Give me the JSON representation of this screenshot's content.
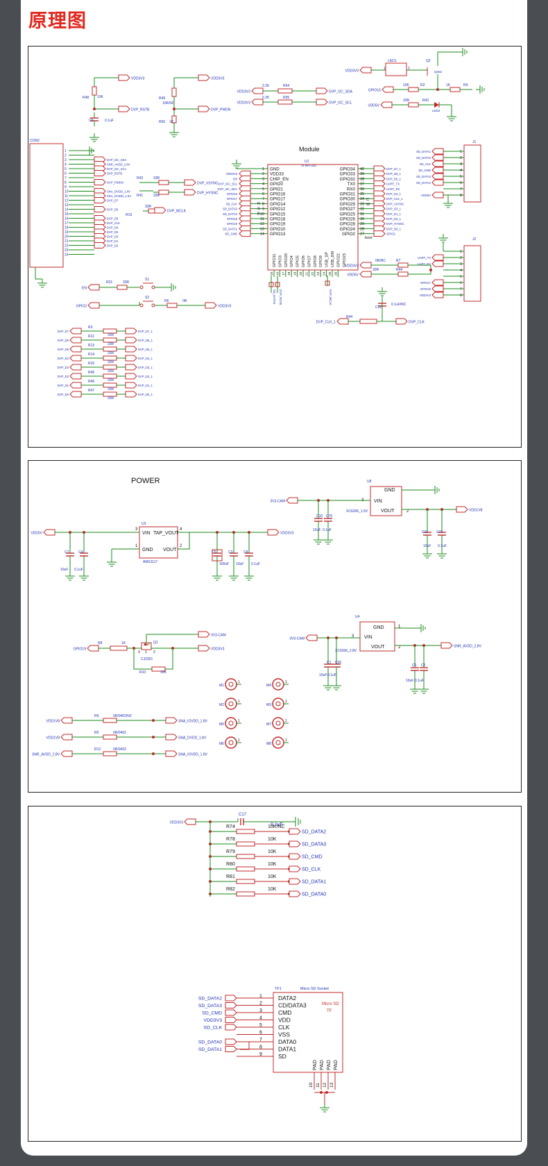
{
  "page_title": "原理图",
  "schematic": {
    "p1_wire_labels": [
      "VDD3V3",
      "VDD3V3",
      "VDD3V3",
      "VDD3V3",
      "VDD3V3",
      "VDD5V"
    ],
    "p1_resistor_labels": [
      "R48",
      "10K",
      "R49",
      "10K/NC",
      "R50",
      "1K",
      "R54",
      "2.2K",
      "R55",
      "2.2K",
      "R1",
      "1K",
      "R2",
      "10K",
      "R4",
      "1K",
      "R42",
      "33R",
      "R43",
      "33R",
      "R41",
      "33R",
      "R19",
      "33R",
      "R21",
      "33R",
      "R6",
      "0R",
      "R7",
      "0R/NC",
      "R44",
      "33R"
    ],
    "p1_cap_labels": [
      "C9",
      "0.1uF",
      "C22",
      "0.1uF/NC"
    ],
    "p1_net_labels": [
      "DVP_RSTB",
      "DVP_PWDN",
      "DVP_I2C_SDA",
      "DVP_I2C_SCL",
      "GPIO16",
      "DVP_MCLK",
      "DVP_VSYNC",
      "DVP_HYSNC",
      "EN",
      "GPIO2",
      "DVP_CLK_1",
      "DVP_CLK"
    ],
    "led_labels": [
      "LED1",
      "LED2",
      "Q2",
      "Q302"
    ],
    "con2_label": "CON2",
    "con2_pins": [
      "1",
      "2",
      "3",
      "4",
      "5",
      "6",
      "7",
      "8",
      "9",
      "10",
      "11",
      "12",
      "13",
      "14",
      "15",
      "16",
      "17",
      "18",
      "19",
      "20",
      "21",
      "22",
      "23",
      "24"
    ],
    "con2_nets": [
      "",
      "",
      "DVP_I2C_SDA",
      "SNR_AVDD_2.8V",
      "DVP_I2C_SCL",
      "DVP_RSTB",
      "",
      "DVP_PWDN",
      "",
      "SNA_DVDD_1.8V",
      "SNA_IOVDD_1.8V",
      "DVP_D7",
      "",
      "DVP_D6",
      "",
      "DVP_D5",
      "DVP_CLK",
      "DVP_D4",
      "DVP_D0",
      "DVP_D3",
      "DVP_D1",
      "DVP_D2",
      "",
      ""
    ],
    "module": {
      "title": "Module",
      "ref": "U1",
      "part": "AI-MH-32S",
      "boot": "boot",
      "left_pins": [
        {
          "num": "1",
          "name": "GND",
          "net": ""
        },
        {
          "num": "2",
          "name": "VDD33",
          "net": "VDD3V3"
        },
        {
          "num": "3",
          "name": "CHIP_EN",
          "net": "EN"
        },
        {
          "num": "4",
          "name": "GPIO0",
          "net": "DVP_I2C_SCL"
        },
        {
          "num": "5",
          "name": "GPIO1",
          "net": "DVP_I2C_SDA"
        },
        {
          "num": "6",
          "name": "GPIO16",
          "net": "GPIO16"
        },
        {
          "num": "7",
          "name": "GPIO17",
          "net": "GPIO17"
        },
        {
          "num": "8",
          "name": "GPIO14",
          "net": "SD_CLK"
        },
        {
          "num": "9",
          "name": "GPIO12",
          "net": "SD_DATA3"
        },
        {
          "num": "10",
          "name": "GPIO15",
          "net": "SD_DATA2"
        },
        {
          "num": "11",
          "name": "GPIO18",
          "net": "GPIO18"
        },
        {
          "num": "12",
          "name": "GPIO19",
          "net": "GPIO19"
        },
        {
          "num": "13",
          "name": "GPIO10",
          "net": "SD_DATA1"
        },
        {
          "num": "14",
          "name": "GPIO13",
          "net": "SD_CMD"
        }
      ],
      "rgb_marks": [
        "R",
        "G",
        "B"
      ],
      "right_pins": [
        {
          "num": "40",
          "name": "GPIO34",
          "net": "DVP_D7_1"
        },
        {
          "num": "39",
          "name": "GPIO33",
          "net": "DVP_D6_1"
        },
        {
          "num": "38",
          "name": "GPIO32",
          "net": "DVP_D5_1"
        },
        {
          "num": "37",
          "name": "TX0",
          "net": "UART_TX"
        },
        {
          "num": "36",
          "name": "RX0",
          "net": "UART_RX"
        },
        {
          "num": "35",
          "name": "GPIO31",
          "net": "DVP_D4_1"
        },
        {
          "num": "34",
          "name": "GPIO30",
          "net": "DVP_CLK_1"
        },
        {
          "num": "33",
          "name": "GPIO29",
          "net": "DVP_VSYNC"
        },
        {
          "num": "32",
          "name": "GPIO27",
          "net": "DVP_D3_1"
        },
        {
          "num": "31",
          "name": "GPIO25",
          "net": "DVP_D1_1"
        },
        {
          "num": "30",
          "name": "GPIO26",
          "net": "DVP_D2_1"
        },
        {
          "num": "29",
          "name": "GPIO28",
          "net": "DVP_HYSNC"
        },
        {
          "num": "28",
          "name": "GPIO24",
          "net": "DVP_D0_1"
        },
        {
          "num": "27",
          "name": "GPIO2",
          "net": "GPIO2"
        }
      ],
      "cw_marks": [
        "C",
        "W"
      ],
      "bottom_pins": [
        "GPIO11",
        "GPIO3",
        "GPIO20",
        "GPIO4",
        "GPIO5",
        "GPIO6",
        "GPIO7",
        "GPIO8",
        "GPIO9",
        "USB_DP",
        "USB_DM",
        "GPIO22",
        "GPIO23"
      ],
      "bottom_nums": [
        "15",
        "16",
        "17",
        "18",
        "19",
        "20",
        "21",
        "22",
        "23",
        "24",
        "25",
        "26"
      ],
      "bottom_nets": [
        "SD_DATA0",
        "DVP_RSTB",
        "DVP_MCLK"
      ]
    },
    "j1": {
      "label": "J1",
      "pins": [
        "1",
        "2",
        "3",
        "4",
        "5",
        "6",
        "7",
        "8"
      ],
      "nets": [
        "SD_DATA1",
        "SD_DATA0",
        "SD_CLK",
        "SD_CMD",
        "SD_DATA3",
        "SD_DATA2",
        "",
        "VDD5V"
      ]
    },
    "j2": {
      "label": "J2",
      "pins": [
        "1",
        "2",
        "3",
        "4",
        "5",
        "6",
        "7",
        "8"
      ],
      "nets": [
        "",
        "UART_TX",
        "UART_RX",
        "",
        "",
        "GPIO17",
        "GPIO18",
        "VDD3V3"
      ]
    },
    "switches": [
      {
        "ref": "S1",
        "net": "EN"
      },
      {
        "ref": "S2",
        "net": "GPIO2"
      }
    ],
    "dvp_map": [
      {
        "from": "DVP_D7",
        "ref": "R3",
        "val": "33R",
        "to": "DVP_D7_1"
      },
      {
        "from": "DVP_D6",
        "ref": "R11",
        "val": "33R",
        "to": "DVP_D6_1"
      },
      {
        "from": "DVP_D5",
        "ref": "R13",
        "val": "33R",
        "to": "DVP_D5_1"
      },
      {
        "from": "DVP_D4",
        "ref": "R14",
        "val": "33R",
        "to": "DVP_D4_1"
      },
      {
        "from": "DVP_D3",
        "ref": "R15",
        "val": "33R",
        "to": "DVP_D3_1"
      },
      {
        "from": "DVP_D2",
        "ref": "R45",
        "val": "33R",
        "to": "DVP_D2_1"
      },
      {
        "from": "DVP_D1",
        "ref": "R46",
        "val": "33R",
        "to": "DVP_D1_1"
      },
      {
        "from": "DVP_D0",
        "ref": "R47",
        "val": "33R",
        "to": "DVP_D0_1"
      }
    ]
  },
  "power": {
    "heading": "POWER",
    "u3": {
      "ref": "U3",
      "part": "AMS1117",
      "pins": [
        "VIN",
        "TAP_VOUT",
        "GND",
        "VOUT"
      ],
      "pin_nums": [
        "3",
        "4",
        "1",
        "2"
      ],
      "in_net": "VDD5V",
      "out_net": "VDD3V3"
    },
    "u3_caps": [
      "C7",
      "C4",
      "C5",
      "C3",
      "C8",
      "10uF",
      "0.1uF",
      "100uF",
      "10uF",
      "0.1uF"
    ],
    "u8": {
      "ref": "U8",
      "part": "XC6206_1.5V",
      "pins": [
        "GND",
        "VIN",
        "VOUT"
      ],
      "pin_nums": [
        "3",
        "2"
      ],
      "in_net": "3V3-CAM",
      "out_net": "VDD1V8"
    },
    "u8_caps": [
      "C10",
      "C70",
      "C11",
      "C73",
      "10uF",
      "0.1uF",
      "10uF",
      "0.1uF"
    ],
    "u4": {
      "ref": "U4",
      "part": "XC6206_2.8V",
      "pins": [
        "GND",
        "VIN",
        "VOUT"
      ],
      "pin_nums": [
        "1",
        "3",
        "2"
      ],
      "in_net": "3V3-CAM",
      "out_net": "SNR_AVDD_2.8V"
    },
    "u4_caps": [
      "C1",
      "C25",
      "C6",
      "C2",
      "10uF",
      "0.1uF",
      "10uF",
      "0.1uF"
    ],
    "q1": {
      "ref": "Q1",
      "part": "CJ2301",
      "pin_nums": [
        "3",
        "1",
        "2"
      ],
      "gate_net": "GPIO19",
      "r_gate": "R8",
      "r_gate_val": "1K",
      "r_pull": "R10",
      "r_pull_val": "10K",
      "out_net": "3V3-CAM",
      "in_net": "VDD3V3"
    },
    "mounts": [
      "M1",
      "M2",
      "M5",
      "M6",
      "M4",
      "M3",
      "M7",
      "M8"
    ],
    "mount_pin": "1",
    "bridges": [
      {
        "from": "VDD1V8",
        "ref": "R9",
        "val": "0R/0402/NC",
        "to": "SNA_IOVDD_1.8V"
      },
      {
        "from": "VDD1V8",
        "ref": "R5",
        "val": "0R/0402",
        "to": "SNA_DVDD_1.8V"
      },
      {
        "from": "SNR_AVDD_2.8V",
        "ref": "R12",
        "val": "0R/0402",
        "to": "SNA_IOVDD_1.8V"
      }
    ]
  },
  "sd": {
    "vdd_net": "VDD3V3",
    "cap": {
      "ref": "C17",
      "val": "0.1uF"
    },
    "pullups": [
      {
        "ref": "R74",
        "val": "10K/NC",
        "net": "SD_DATA2"
      },
      {
        "ref": "R78",
        "val": "10K",
        "net": "SD_DATA3"
      },
      {
        "ref": "R79",
        "val": "10K",
        "net": "SD_CMD"
      },
      {
        "ref": "R80",
        "val": "10K",
        "net": "SD_CLK"
      },
      {
        "ref": "R81",
        "val": "10K",
        "net": "SD_DATA1"
      },
      {
        "ref": "R82",
        "val": "10K",
        "net": "SD_DATA0"
      }
    ],
    "socket": {
      "ref": "TF1",
      "part": "Micro SD Socket",
      "inner1": "Micro SD",
      "inner2": "TF",
      "pins": [
        {
          "num": "1",
          "name": "DATA2",
          "net": "SD_DATA2"
        },
        {
          "num": "2",
          "name": "CD/DATA3",
          "net": "SD_DATA3"
        },
        {
          "num": "3",
          "name": "CMD",
          "net": "SD_CMD"
        },
        {
          "num": "4",
          "name": "VDD",
          "net": "VDD3V3"
        },
        {
          "num": "5",
          "name": "CLK",
          "net": "SD_CLK"
        },
        {
          "num": "6",
          "name": "VSS",
          "net": ""
        },
        {
          "num": "7",
          "name": "DATA0",
          "net": "SD_DATA0"
        },
        {
          "num": "8",
          "name": "DATA1",
          "net": "SD_DATA1"
        },
        {
          "num": "9",
          "name": "SD",
          "net": ""
        }
      ],
      "pads": [
        "PAD",
        "PAD",
        "PAD",
        "PAD"
      ],
      "pad_nums": [
        "10",
        "11",
        "12",
        "13"
      ]
    }
  },
  "colors": {
    "title": "#e0281e",
    "wire": "#1a8a1a",
    "part": "#c0282a",
    "net_text": "#1e2fb0",
    "frame": "#222222",
    "bg": "#4a4d52"
  }
}
